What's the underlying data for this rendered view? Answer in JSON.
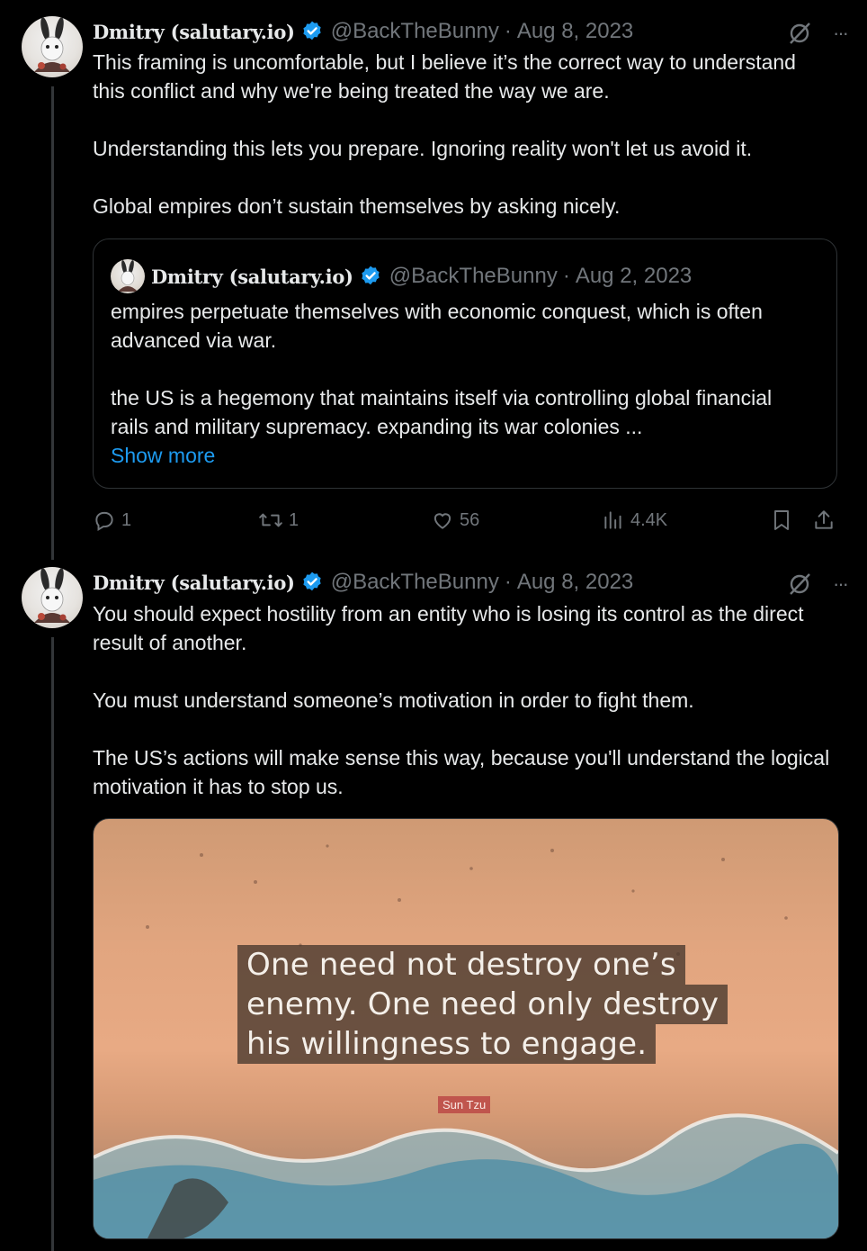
{
  "tweets": [
    {
      "author": {
        "name": "Dmitry (salutary.io)",
        "handle": "@BackTheBunny",
        "date": "Aug 8, 2023",
        "verified": true
      },
      "paragraphs": [
        "This framing is uncomfortable, but I believe it’s the correct way to understand this conflict and why we're being treated the way we are.",
        "Understanding this lets you prepare. Ignoring reality won't let us avoid it.",
        "Global empires don’t sustain themselves by asking nicely."
      ],
      "quoted": {
        "author": {
          "name": "Dmitry (salutary.io)",
          "handle": "@BackTheBunny",
          "date": "Aug 2, 2023"
        },
        "paragraphs": [
          "empires perpetuate themselves with economic conquest, which is often advanced via war.",
          "the US is a hegemony that maintains itself via controlling global financial rails and military supremacy. expanding its war colonies ..."
        ],
        "show_more": "Show more"
      },
      "stats": {
        "replies": "1",
        "reposts": "1",
        "likes": "56",
        "views": "4.4K"
      }
    },
    {
      "author": {
        "name": "Dmitry (salutary.io)",
        "handle": "@BackTheBunny",
        "date": "Aug 8, 2023",
        "verified": true
      },
      "paragraphs": [
        "You should expect hostility from an entity who is losing its control as the direct result of another.",
        "You must understand someone’s motivation in order to fight them.",
        "The US’s actions will make sense this way, because you'll understand the logical motivation it has to stop us."
      ],
      "image": {
        "quote_lines": [
          "One need not destroy one’s",
          "enemy. One need only destroy",
          "his willingness to engage."
        ],
        "attribution": "Sun Tzu"
      }
    }
  ],
  "ui": {
    "separator": "·",
    "more": "···"
  },
  "colors": {
    "background": "#000000",
    "text": "#e7e9ea",
    "muted": "#71767b",
    "link": "#1d9bf0",
    "verified": "#1d9bf0",
    "border": "#2f3336"
  }
}
